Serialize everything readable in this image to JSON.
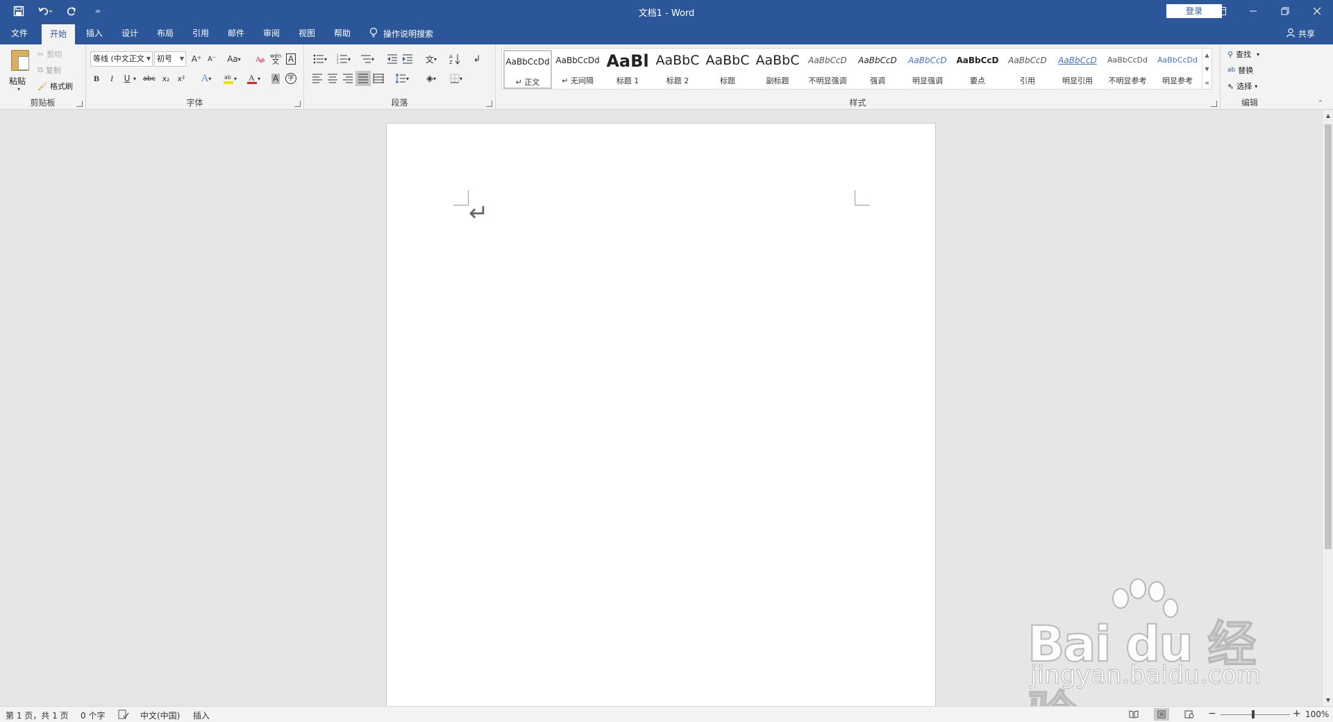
{
  "window": {
    "title": "文档1  -  Word",
    "login_label": "登录"
  },
  "qat": {
    "save_icon": "save-icon",
    "undo_icon": "undo-icon",
    "redo_icon": "redo-icon",
    "customize_icon": "customize-qat-icon"
  },
  "tabs": [
    {
      "label": "文件"
    },
    {
      "label": "开始"
    },
    {
      "label": "插入"
    },
    {
      "label": "设计"
    },
    {
      "label": "布局"
    },
    {
      "label": "引用"
    },
    {
      "label": "邮件"
    },
    {
      "label": "审阅"
    },
    {
      "label": "视图"
    },
    {
      "label": "帮助"
    }
  ],
  "tellme": {
    "label": "操作说明搜索"
  },
  "share": {
    "label": "共享"
  },
  "clipboard": {
    "group_label": "剪贴板",
    "paste": "粘贴",
    "cut": "剪切",
    "copy": "复制",
    "format_painter": "格式刷"
  },
  "font": {
    "group_label": "字体",
    "font_name": "等线 (中文正文",
    "font_size": "初号",
    "grow": "A⁺",
    "shrink": "A⁻",
    "change_case": "Aa",
    "bold": "B",
    "italic": "I",
    "underline": "U",
    "strike": "abc",
    "subscript": "x₂",
    "superscript": "x²",
    "wen": "wén",
    "char_border": "A",
    "char_shading": "A",
    "enclose": "字",
    "font_color_hex": "#e02020",
    "highlight_color_hex": "#f0e000"
  },
  "paragraph": {
    "group_label": "段落"
  },
  "styles": {
    "group_label": "样式",
    "items": [
      {
        "preview": "AaBbCcDd",
        "name": "正文"
      },
      {
        "preview": "AaBbCcDd",
        "name": "无间隔"
      },
      {
        "preview": "AaBl",
        "name": "标题 1"
      },
      {
        "preview": "AaBbC",
        "name": "标题 2"
      },
      {
        "preview": "AaBbC",
        "name": "标题"
      },
      {
        "preview": "AaBbC",
        "name": "副标题"
      },
      {
        "preview": "AaBbCcD",
        "name": "不明显强调"
      },
      {
        "preview": "AaBbCcD",
        "name": "强调"
      },
      {
        "preview": "AaBbCcD",
        "name": "明显强调"
      },
      {
        "preview": "AaBbCcD",
        "name": "要点"
      },
      {
        "preview": "AaBbCcD",
        "name": "引用"
      },
      {
        "preview": "AaBbCcD",
        "name": "明显引用"
      },
      {
        "preview": "AaBbCcDd",
        "name": "不明显参考"
      },
      {
        "preview": "AaBbCcDd",
        "name": "明显参考"
      }
    ]
  },
  "editing": {
    "group_label": "编辑",
    "find": "查找",
    "replace": "替换",
    "select": "选择"
  },
  "document": {
    "paragraph_mark": "↵"
  },
  "status": {
    "page": "第 1 页，共 1 页",
    "words": "0 个字",
    "language": "中文(中国)",
    "mode": "插入",
    "zoom": "100%",
    "zoom_out": "−",
    "zoom_in": "+"
  },
  "watermark": {
    "brand": "Bai du 经验",
    "url": "jingyan.baidu.com"
  }
}
